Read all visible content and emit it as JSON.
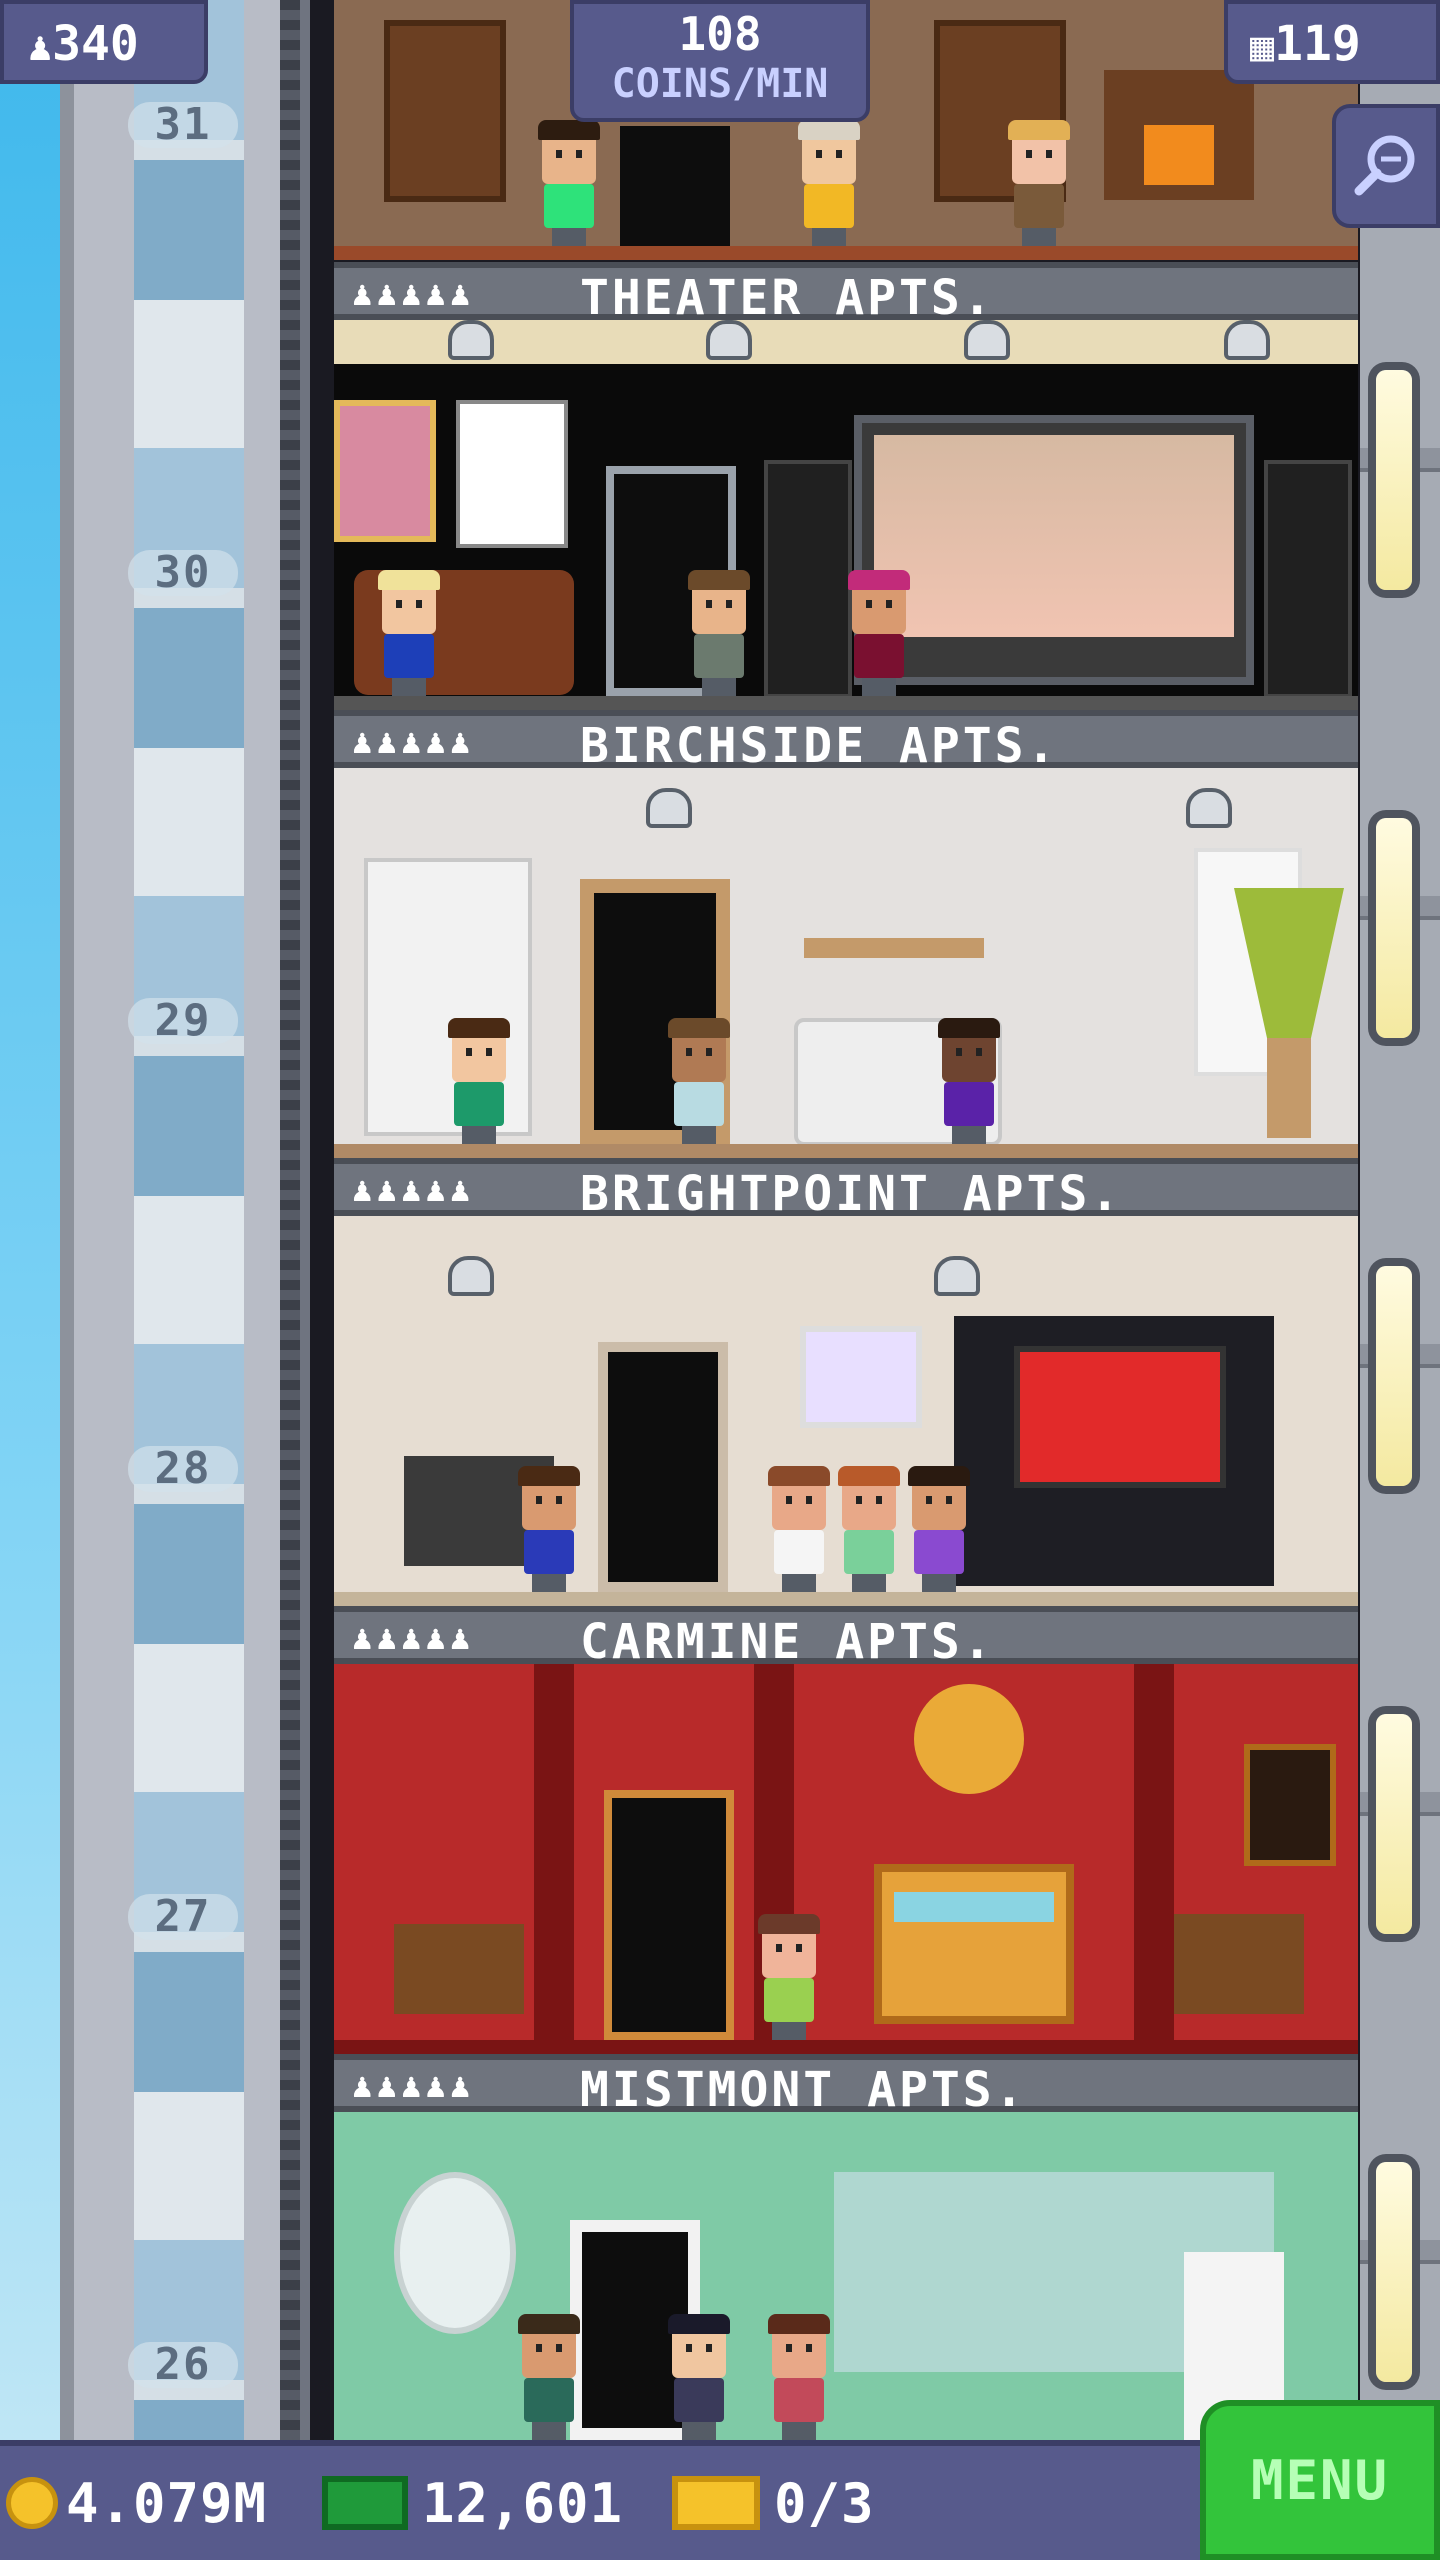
{
  "hud": {
    "population": "340",
    "coins_per_min_value": "108",
    "coins_per_min_label": "COINS/MIN",
    "floor_count": "119",
    "zoom_icon": "magnifier-icon"
  },
  "elevator": {
    "floor_numbers": [
      "31",
      "30",
      "29",
      "28",
      "27",
      "26"
    ]
  },
  "floors": [
    {
      "name": "THEATER APTS.",
      "occupancy": "♟♟♟♟♟"
    },
    {
      "name": "BIRCHSIDE APTS.",
      "occupancy": "♟♟♟♟♟"
    },
    {
      "name": "BRIGHTPOINT APTS.",
      "occupancy": "♟♟♟♟♟"
    },
    {
      "name": "CARMINE APTS.",
      "occupancy": "♟♟♟♟♟"
    },
    {
      "name": "MISTMONT APTS.",
      "occupancy": "♟♟♟♟♟"
    }
  ],
  "bottom": {
    "coins": "4.079M",
    "bux": "12,601",
    "tickets": "0/3",
    "menu_label": "MENU"
  },
  "colors": {
    "hud_bg": "#575a8c",
    "menu_green": "#33c43b",
    "theater_wall": "#0a0a0a",
    "birchside_wall": "#e4e1df",
    "brightpoint_wall": "#e6ddd2",
    "carmine_wall": "#b82a2a",
    "mistmont_wall": "#7fcaa6"
  }
}
